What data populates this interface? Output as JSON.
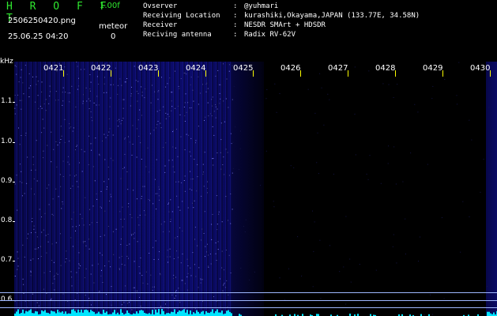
{
  "header": {
    "app_title": "H R O F F T",
    "app_version": "1.00f",
    "file_name": "2506250420.png",
    "datetime": "25.06.25 04:20",
    "meteor_label": "meteor",
    "meteor_count": "0"
  },
  "info": [
    {
      "key": "Ovserver",
      "sep": ":",
      "value": "@yuhmari"
    },
    {
      "key": "Receiving Location",
      "sep": ":",
      "value": "kurashiki,Okayama,JAPAN (133.77E, 34.58N)"
    },
    {
      "key": "Receiver",
      "sep": ":",
      "value": "NESDR SMArt + HDSDR"
    },
    {
      "key": "Reciving antenna",
      "sep": ":",
      "value": "Radix RV-62V"
    }
  ],
  "y_axis": {
    "unit": "kHz",
    "ticks": [
      "1.1",
      "1.0",
      "0.9",
      "0.8",
      "0.7",
      "0.6"
    ]
  },
  "time_axis": {
    "labels": [
      "0421",
      "0422",
      "0423",
      "0424",
      "0425",
      "0426",
      "0427",
      "0428",
      "0429",
      "0430"
    ]
  },
  "colors": {
    "title_green": "#2fe62f",
    "signal_blue": "#0a0a62",
    "tick_yellow": "#ffff00",
    "baseline_cyan": "#00e5ff"
  }
}
